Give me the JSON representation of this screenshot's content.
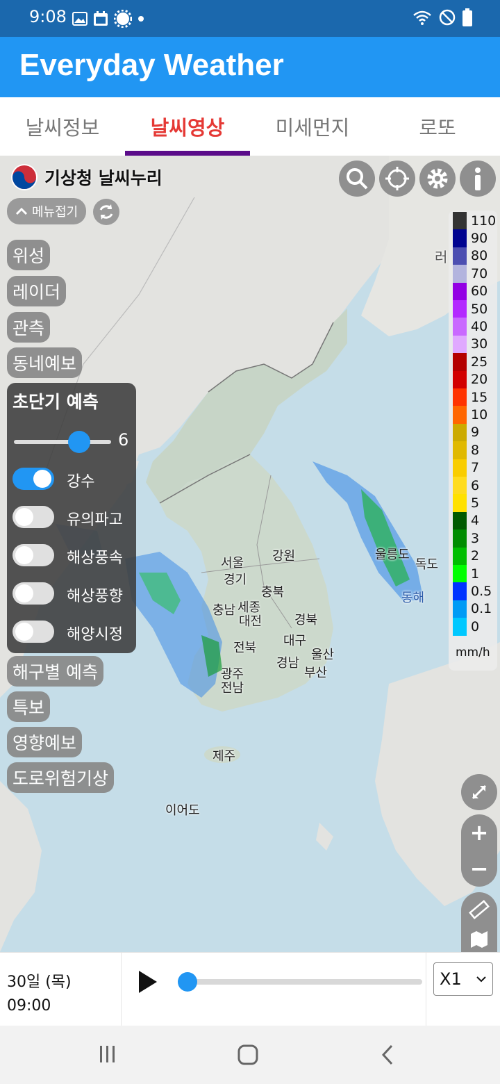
{
  "status_bar": {
    "time": "9:08",
    "left_icons": [
      "image-icon",
      "calendar-icon",
      "settings-gear-icon",
      "dot-icon"
    ],
    "right_icons": [
      "wifi-icon",
      "do-not-disturb-icon",
      "battery-icon"
    ]
  },
  "app": {
    "title": "Everyday Weather"
  },
  "tabs": [
    {
      "label": "날씨정보",
      "active": false
    },
    {
      "label": "날씨영상",
      "active": true
    },
    {
      "label": "미세먼지",
      "active": false
    },
    {
      "label": "로또",
      "active": false
    }
  ],
  "map_header": {
    "provider": "기상청 날씨누리",
    "tools": [
      "search-icon",
      "locate-icon",
      "settings-icon",
      "info-icon"
    ]
  },
  "menu": {
    "fold_label": "메뉴접기",
    "items": [
      "위성",
      "레이더",
      "관측",
      "동네예보"
    ],
    "more_items": [
      "해구별 예측",
      "특보",
      "영향예보",
      "도로위험기상"
    ]
  },
  "forecast_panel": {
    "title": "초단기 예측",
    "slider_value": "6",
    "layers": [
      {
        "label": "강수",
        "on": true
      },
      {
        "label": "유의파고",
        "on": false
      },
      {
        "label": "해상풍속",
        "on": false
      },
      {
        "label": "해상풍향",
        "on": false
      },
      {
        "label": "해양시정",
        "on": false
      }
    ]
  },
  "legend": {
    "unit": "mm/h",
    "entries": [
      {
        "value": "110",
        "color": "#333333"
      },
      {
        "value": "90",
        "color": "#000390"
      },
      {
        "value": "80",
        "color": "#4c4eb1"
      },
      {
        "value": "70",
        "color": "#b3b4de"
      },
      {
        "value": "60",
        "color": "#9300e4"
      },
      {
        "value": "50",
        "color": "#b329ff"
      },
      {
        "value": "40",
        "color": "#c969ff"
      },
      {
        "value": "30",
        "color": "#e0a9ff"
      },
      {
        "value": "25",
        "color": "#b40000"
      },
      {
        "value": "20",
        "color": "#d20000"
      },
      {
        "value": "15",
        "color": "#ff3300"
      },
      {
        "value": "10",
        "color": "#ff6600"
      },
      {
        "value": "9",
        "color": "#ccaa00"
      },
      {
        "value": "8",
        "color": "#e0b900"
      },
      {
        "value": "7",
        "color": "#f9cd00"
      },
      {
        "value": "6",
        "color": "#ffdc1f"
      },
      {
        "value": "5",
        "color": "#ffe100"
      },
      {
        "value": "4",
        "color": "#005a00"
      },
      {
        "value": "3",
        "color": "#008c00"
      },
      {
        "value": "2",
        "color": "#00be00"
      },
      {
        "value": "1",
        "color": "#00ff00"
      },
      {
        "value": "0.5",
        "color": "#0033ff"
      },
      {
        "value": "0.1",
        "color": "#009bf5"
      },
      {
        "value": "0",
        "color": "#00c8ff"
      }
    ]
  },
  "map_labels": {
    "russia": "러",
    "seoul": "서울",
    "gyeonggi": "경기",
    "gangwon": "강원",
    "chungbuk": "충북",
    "chungnam": "충남",
    "sejong": "세종",
    "daejeon": "대전",
    "gyeongbuk": "경북",
    "jeonbuk": "전북",
    "daegu": "대구",
    "ulsan": "울산",
    "gyeongnam": "경남",
    "busan": "부산",
    "gwangju": "광주",
    "jeonnam": "전남",
    "jeju": "제주",
    "ieodo": "이어도",
    "ulleungdo": "울릉도",
    "dokdo": "독도",
    "donghae": "동해"
  },
  "bottom": {
    "date": "30일 (목)",
    "time": "09:00",
    "speed": "X1",
    "progress": 0
  }
}
